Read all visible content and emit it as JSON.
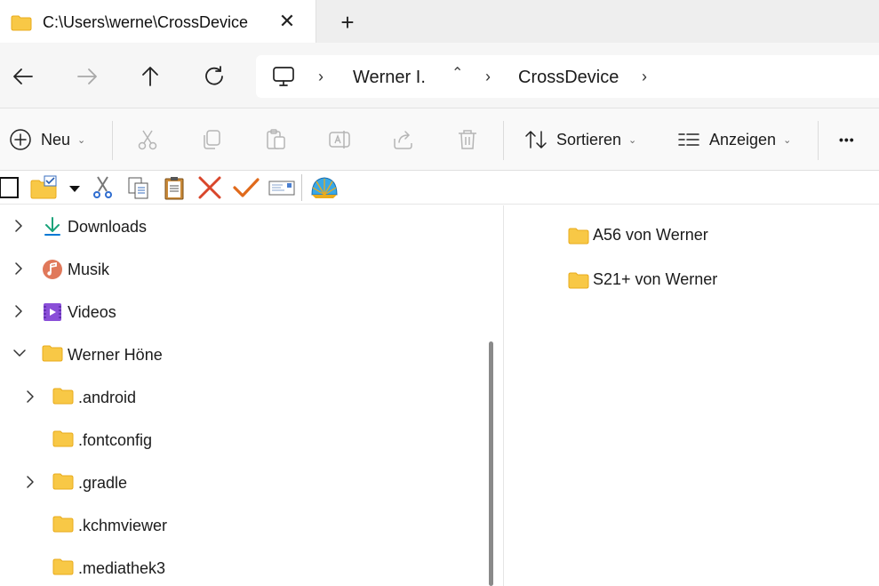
{
  "tab": {
    "title": "C:\\Users\\werne\\CrossDevice",
    "close_glyph": "✕",
    "new_tab_glyph": "+"
  },
  "address": {
    "separator": "›",
    "crumbs": [
      "Werner I.",
      "CrossDevice"
    ],
    "overflow_glyph": "⌃"
  },
  "commandbar": {
    "new_label": "Neu",
    "sort_label": "Sortieren",
    "view_label": "Anzeigen",
    "more_glyph": "•••",
    "chevron": "⌄"
  },
  "tree": {
    "items": [
      {
        "label": "Downloads",
        "icon": "download-icon",
        "expanded": false,
        "has_children": true
      },
      {
        "label": "Musik",
        "icon": "music-icon",
        "expanded": false,
        "has_children": true
      },
      {
        "label": "Videos",
        "icon": "video-icon",
        "expanded": false,
        "has_children": true
      },
      {
        "label": "Werner Höne",
        "icon": "folder-icon",
        "expanded": true,
        "has_children": true
      },
      {
        "label": ".android",
        "icon": "folder-icon",
        "has_children": true
      },
      {
        "label": ".fontconfig",
        "icon": "folder-icon",
        "has_children": false
      },
      {
        "label": ".gradle",
        "icon": "folder-icon",
        "has_children": true
      },
      {
        "label": ".kchmviewer",
        "icon": "folder-icon",
        "has_children": false
      },
      {
        "label": ".mediathek3",
        "icon": "folder-icon",
        "has_children": false
      }
    ]
  },
  "content": {
    "items": [
      {
        "label": "A56 von Werner",
        "icon": "folder-icon"
      },
      {
        "label": "S21+ von Werner",
        "icon": "folder-icon"
      }
    ]
  },
  "colors": {
    "folder": "#f8c846",
    "folder_dark": "#e9ab1c",
    "accent": "#0063b1",
    "delete_red": "#d9462b",
    "check_orange": "#e06a1b"
  }
}
